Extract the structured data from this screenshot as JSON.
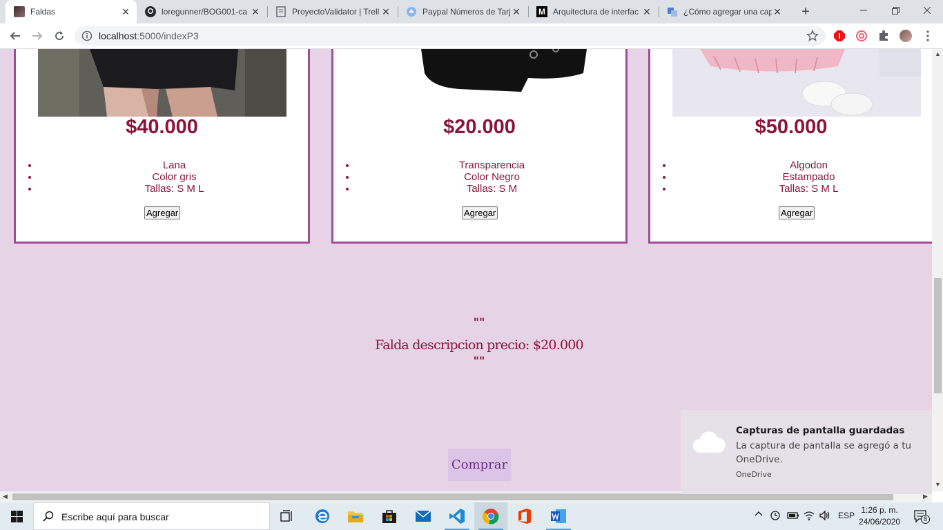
{
  "browser": {
    "tabs": [
      {
        "title": "Faldas",
        "active": true
      },
      {
        "title": "loregunner/BOG001-ca"
      },
      {
        "title": "ProyectoValidator | Trell"
      },
      {
        "title": "Paypal Números de Tarj"
      },
      {
        "title": "Arquitectura de interfac"
      },
      {
        "title": "¿Cómo agregar una cap"
      }
    ],
    "url_host": "localhost",
    "url_rest": ":5000/indexP3"
  },
  "products": [
    {
      "price": "$40.000",
      "features": [
        "Lana",
        "Color gris",
        "Tallas: S M L"
      ],
      "button": "Agregar"
    },
    {
      "price": "$20.000",
      "features": [
        "Transparencia",
        "Color Negro",
        "Tallas: S M"
      ],
      "button": "Agregar"
    },
    {
      "price": "$50.000",
      "features": [
        "Algodon",
        "Estampado",
        "Tallas: S M L"
      ],
      "button": "Agregar"
    }
  ],
  "description": {
    "quote_top": "\"\"",
    "text": "Falda descripcion precio: $20.000",
    "quote_bottom": "\"\""
  },
  "buy_button": "Comprar",
  "notification": {
    "title": "Capturas de pantalla guardadas",
    "body": "La captura de pantalla se agregó a tu OneDrive.",
    "source": "OneDrive"
  },
  "taskbar": {
    "search_placeholder": "Escribe aquí para buscar",
    "language": "ESP",
    "time": "1:26 p. m.",
    "date": "24/06/2020",
    "notification_count": "8"
  }
}
